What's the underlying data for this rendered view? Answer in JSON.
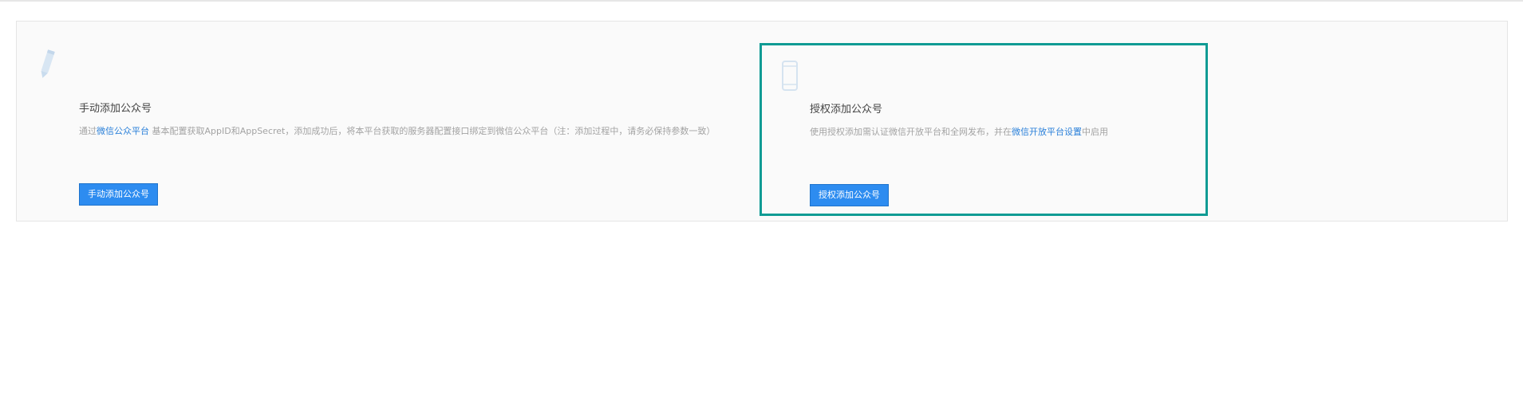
{
  "manual_card": {
    "icon": "pencil-icon",
    "title": "手动添加公众号",
    "desc_prefix": "通过",
    "desc_link": "微信公众平台",
    "desc_suffix": " 基本配置获取AppID和AppSecret，添加成功后，将本平台获取的服务器配置接口绑定到微信公众平台（注：添加过程中，请务必保持参数一致）",
    "button_label": "手动添加公众号"
  },
  "auth_card": {
    "icon": "phone-icon",
    "title": "授权添加公众号",
    "desc_prefix": "使用授权添加需认证微信开放平台和全网发布，并在",
    "desc_link": "微信开放平台设置",
    "desc_suffix": "中启用",
    "button_label": "授权添加公众号",
    "highlight_color": "#0f9b94"
  },
  "colors": {
    "button": "#2d8cf0",
    "link": "#2b80d9",
    "panel_background": "#fafafa"
  }
}
